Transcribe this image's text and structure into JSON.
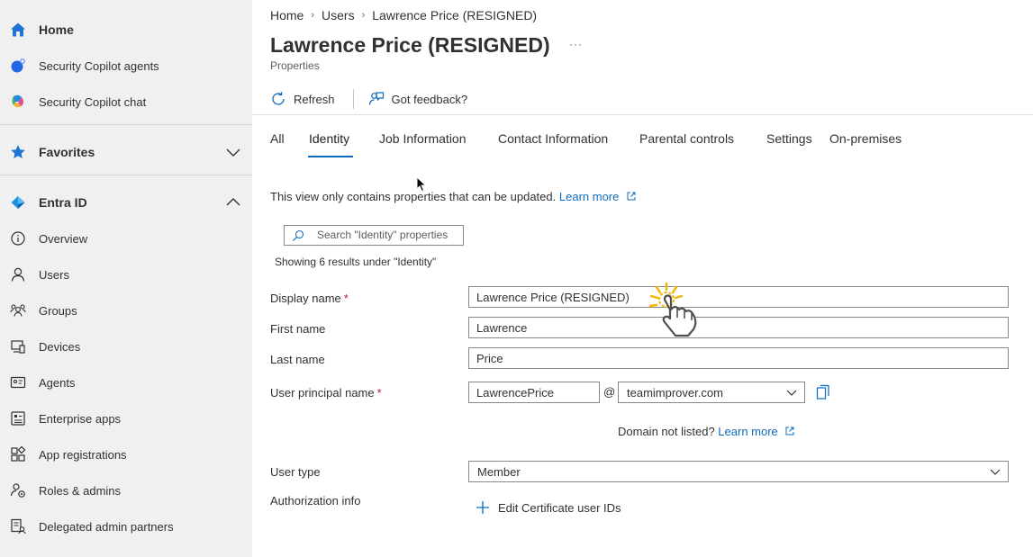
{
  "sidebar": {
    "items": [
      {
        "label": "Home",
        "icon": "home-icon",
        "bold": true
      },
      {
        "label": "Security Copilot agents",
        "icon": "copilot-agents-icon"
      },
      {
        "label": "Security Copilot chat",
        "icon": "copilot-chat-icon"
      },
      {
        "label": "Favorites",
        "icon": "star-icon",
        "bold": true,
        "chevron": "down"
      },
      {
        "label": "Entra ID",
        "icon": "entra-id-icon",
        "bold": true,
        "chevron": "up"
      },
      {
        "label": "Overview",
        "icon": "info-icon"
      },
      {
        "label": "Users",
        "icon": "user-icon"
      },
      {
        "label": "Groups",
        "icon": "groups-icon"
      },
      {
        "label": "Devices",
        "icon": "devices-icon"
      },
      {
        "label": "Agents",
        "icon": "agents-icon"
      },
      {
        "label": "Enterprise apps",
        "icon": "enterprise-apps-icon"
      },
      {
        "label": "App registrations",
        "icon": "app-registrations-icon"
      },
      {
        "label": "Roles & admins",
        "icon": "roles-icon"
      },
      {
        "label": "Delegated admin partners",
        "icon": "delegated-partners-icon"
      }
    ]
  },
  "breadcrumb": {
    "home": "Home",
    "users": "Users",
    "current": "Lawrence Price (RESIGNED)"
  },
  "page": {
    "title": "Lawrence Price (RESIGNED)",
    "more": "···",
    "subtitle": "Properties"
  },
  "toolbar": {
    "refresh_label": "Refresh",
    "feedback_label": "Got feedback?"
  },
  "tabs": [
    "All",
    "Identity",
    "Job Information",
    "Contact Information",
    "Parental controls",
    "Settings",
    "On-premises"
  ],
  "active_tab": "Identity",
  "info": {
    "text": "This view only contains properties that can be updated.",
    "link": "Learn more"
  },
  "search": {
    "placeholder": "Search \"Identity\" properties"
  },
  "results_text": "Showing 6 results under \"Identity\"",
  "form": {
    "display_name": {
      "label": "Display name",
      "required": "*",
      "value": "Lawrence Price (RESIGNED)"
    },
    "first_name": {
      "label": "First name",
      "value": "Lawrence"
    },
    "last_name": {
      "label": "Last name",
      "value": "Price"
    },
    "upn": {
      "label": "User principal name",
      "required": "*",
      "value": "LawrencePrice",
      "at": "@",
      "domain": "teamimprover.com"
    },
    "domain_note": {
      "text": "Domain not listed?",
      "link": "Learn more"
    },
    "user_type": {
      "label": "User type",
      "value": "Member"
    },
    "auth_info": {
      "label": "Authorization info",
      "action": "Edit Certificate user IDs"
    }
  },
  "colors": {
    "accent": "#0f6cbd",
    "sidebar_bg": "#f0f0f0",
    "required": "#a4262c"
  }
}
